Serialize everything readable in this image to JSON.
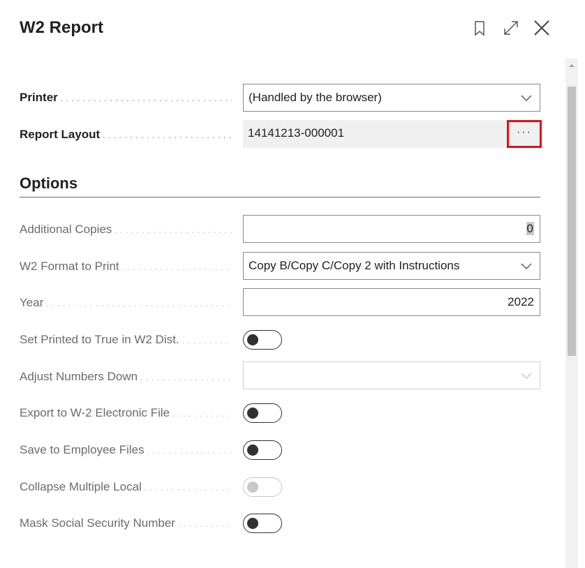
{
  "dialog": {
    "title": "W2 Report",
    "icons": [
      "bookmark-icon",
      "expand-icon",
      "close-icon"
    ]
  },
  "printer": {
    "label": "Printer",
    "value": "(Handled by the browser)"
  },
  "report_layout": {
    "label": "Report Layout",
    "value": "14141213-000001",
    "lookup_label": "···"
  },
  "options": {
    "title": "Options",
    "additional_copies": {
      "label": "Additional Copies",
      "value": "0"
    },
    "w2_format": {
      "label": "W2 Format to Print",
      "value": "Copy B/Copy C/Copy 2 with Instructions"
    },
    "year": {
      "label": "Year",
      "value": "2022"
    },
    "set_printed": {
      "label": "Set Printed to True in W2 Dist.",
      "checked": false
    },
    "adjust_numbers": {
      "label": "Adjust Numbers Down",
      "value": "",
      "disabled": true
    },
    "export_w2": {
      "label": "Export to W-2 Electronic File",
      "checked": false
    },
    "save_employee": {
      "label": "Save to Employee Files",
      "checked": false
    },
    "collapse_local": {
      "label": "Collapse Multiple Local",
      "checked": false,
      "disabled": true
    },
    "mask_ssn": {
      "label": "Mask Social Security Number",
      "checked": false
    }
  },
  "colors": {
    "highlight_border": "#e0101a",
    "toggle_off": "#323130",
    "readonly_bg": "#f0f0f0"
  }
}
